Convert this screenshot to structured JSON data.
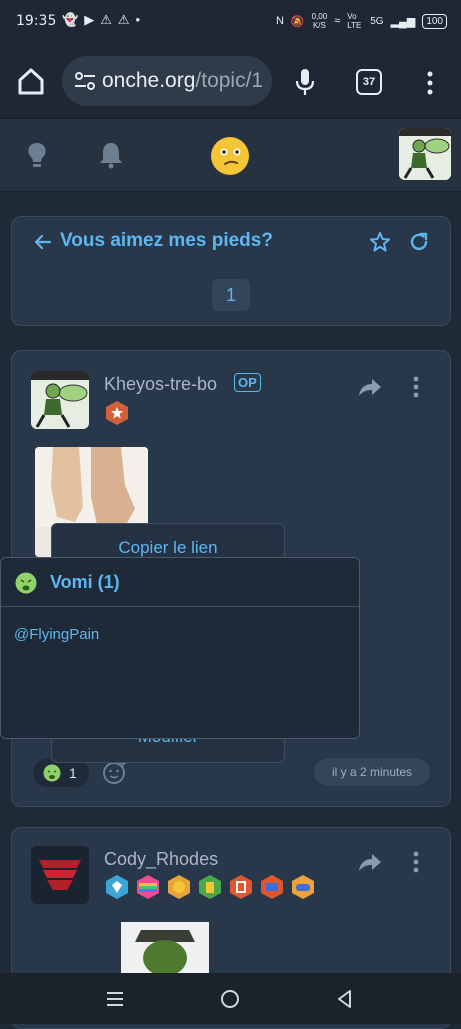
{
  "status_bar": {
    "time": "19:35",
    "network_speed": "0,00",
    "network_unit": "K/S",
    "volte": "Vo LTE",
    "signal": "5G",
    "battery": "100"
  },
  "browser": {
    "url_domain": "onche.org",
    "url_path": "/topic/1",
    "tab_count": "37"
  },
  "topic": {
    "title": "Vous aimez mes pieds?",
    "page": "1"
  },
  "posts": [
    {
      "author": "Kheyos-tre-bo",
      "op_badge": "OP",
      "reaction_count": "1",
      "time": "il y a 2 minutes"
    },
    {
      "author": "Cody_Rhodes"
    }
  ],
  "context_menu": {
    "copy_link": "Copier le lien",
    "edit": "Modifier"
  },
  "reaction_popup": {
    "title": "Vomi (1)",
    "users": [
      "@FlyingPain"
    ]
  },
  "colors": {
    "accent": "#5eb6ef",
    "background": "#1f2a37",
    "card": "#28374a"
  }
}
